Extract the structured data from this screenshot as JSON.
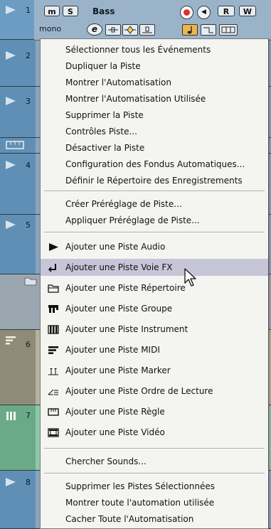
{
  "tracks": [
    {
      "number": "1",
      "kind": "audio-selected"
    },
    {
      "number": "2",
      "kind": "audio"
    },
    {
      "number": "3",
      "kind": "audio"
    },
    {
      "number": "",
      "kind": "ruler"
    },
    {
      "number": "4",
      "kind": "audio"
    },
    {
      "number": "5",
      "kind": "audio"
    },
    {
      "number": "",
      "kind": "folder"
    },
    {
      "number": "6",
      "kind": "midi"
    },
    {
      "number": "7",
      "kind": "instrument"
    },
    {
      "number": "8",
      "kind": "audio"
    }
  ],
  "track1": {
    "mute_label": "m",
    "solo_label": "S",
    "name": "Bass",
    "read_label": "R",
    "write_label": "W",
    "channel_mode": "mono",
    "edit_label": "e"
  },
  "menu": {
    "items": [
      {
        "label": "Sélectionner tous les Événements",
        "icon": ""
      },
      {
        "label": "Dupliquer la Piste",
        "icon": ""
      },
      {
        "label": "Montrer l'Automatisation",
        "icon": ""
      },
      {
        "label": "Montrer l'Automatisation Utilisée",
        "icon": ""
      },
      {
        "label": "Supprimer la Piste",
        "icon": ""
      },
      {
        "label": "Contrôles Piste...",
        "icon": ""
      },
      {
        "label": "Désactiver la Piste",
        "icon": ""
      },
      {
        "label": "Configuration des Fondus Automatiques...",
        "icon": ""
      },
      {
        "label": "Définir le Répertoire des Enregistrements",
        "icon": ""
      },
      {
        "label": "Créer Préréglage de Piste...",
        "icon": ""
      },
      {
        "label": "Appliquer Préréglage de Piste...",
        "icon": ""
      },
      {
        "label": "Ajouter une Piste Audio",
        "icon": "audio-track-icon"
      },
      {
        "label": "Ajouter une Piste Voie FX",
        "icon": "fx-channel-icon",
        "highlighted": true
      },
      {
        "label": "Ajouter une Piste Répertoire",
        "icon": "folder-track-icon"
      },
      {
        "label": "Ajouter une Piste Groupe",
        "icon": "group-track-icon"
      },
      {
        "label": "Ajouter une Piste Instrument",
        "icon": "instrument-track-icon"
      },
      {
        "label": "Ajouter une Piste MIDI",
        "icon": "midi-track-icon"
      },
      {
        "label": "Ajouter une Piste Marker",
        "icon": "marker-track-icon"
      },
      {
        "label": "Ajouter une Piste Ordre de Lecture",
        "icon": "play-order-icon"
      },
      {
        "label": "Ajouter une Piste Règle",
        "icon": "ruler-track-icon"
      },
      {
        "label": "Ajouter une Piste Vidéo",
        "icon": "video-track-icon"
      },
      {
        "label": "Chercher Sounds...",
        "icon": ""
      },
      {
        "label": "Supprimer les Pistes Sélectionnées",
        "icon": ""
      },
      {
        "label": "Montrer toute l'automation utilisée",
        "icon": ""
      },
      {
        "label": "Cacher Toute l'Automatisation",
        "icon": ""
      }
    ]
  },
  "colors": {
    "highlight": "#c7c5d8",
    "record": "#e0302b",
    "orange_button": "#f0b54b"
  }
}
